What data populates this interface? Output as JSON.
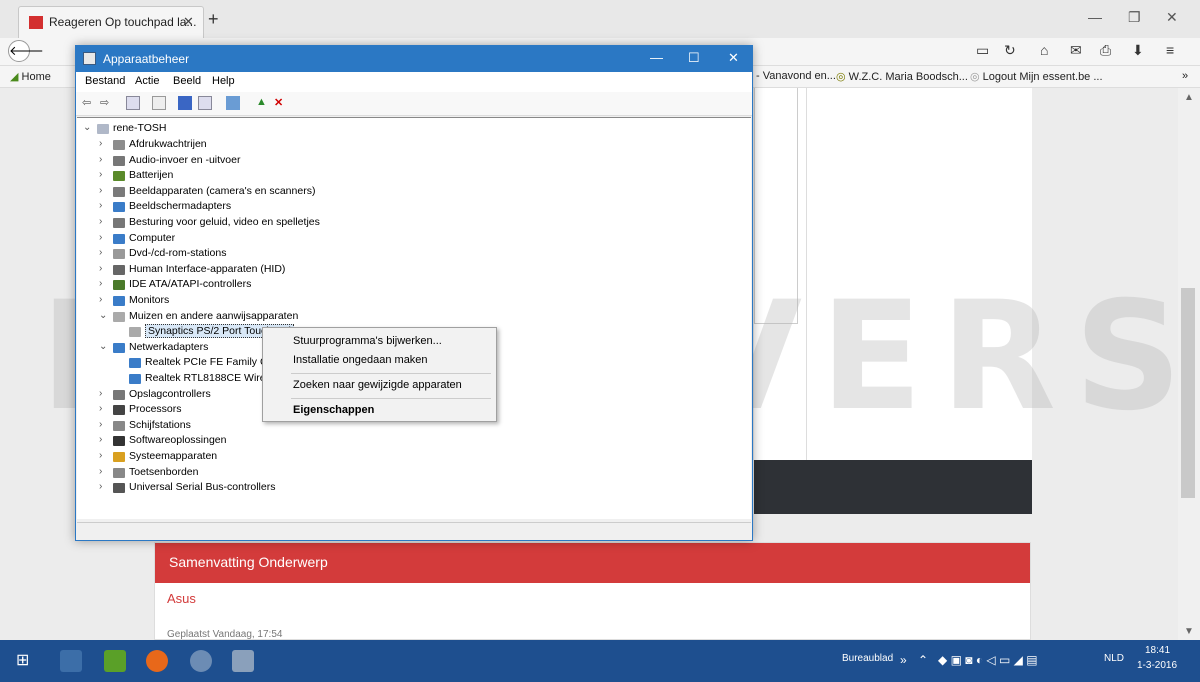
{
  "browser": {
    "tab_title": "Reageren Op touchpad la...",
    "bookmarks": {
      "home": "Home",
      "vanavond": "- Vanavond en...",
      "wzc": "W.Z.C. Maria Boodsch...",
      "logout": "Logout Mijn essent.be ..."
    }
  },
  "device_manager": {
    "title": "Apparaatbeheer",
    "menu": [
      "Bestand",
      "Actie",
      "Beeld",
      "Help"
    ],
    "root": "rene-TOSH",
    "nodes": [
      {
        "label": "Afdrukwachtrijen",
        "expanded": false
      },
      {
        "label": "Audio-invoer en -uitvoer",
        "expanded": false
      },
      {
        "label": "Batterijen",
        "expanded": false
      },
      {
        "label": "Beeldapparaten (camera's en scanners)",
        "expanded": false
      },
      {
        "label": "Beeldschermadapters",
        "expanded": false
      },
      {
        "label": "Besturing voor geluid, video en spelletjes",
        "expanded": false
      },
      {
        "label": "Computer",
        "expanded": false
      },
      {
        "label": "Dvd-/cd-rom-stations",
        "expanded": false
      },
      {
        "label": "Human Interface-apparaten (HID)",
        "expanded": false
      },
      {
        "label": "IDE ATA/ATAPI-controllers",
        "expanded": false
      },
      {
        "label": "Monitors",
        "expanded": false
      },
      {
        "label": "Muizen en andere aanwijsapparaten",
        "expanded": true
      },
      {
        "label": "Synaptics PS/2 Port TouchPad",
        "child": true,
        "selected": true
      },
      {
        "label": "Netwerkadapters",
        "expanded": true
      },
      {
        "label": "Realtek PCIe FE Family Co",
        "child": true
      },
      {
        "label": "Realtek RTL8188CE Wirele",
        "child": true
      },
      {
        "label": "Opslagcontrollers",
        "expanded": false
      },
      {
        "label": "Processors",
        "expanded": false
      },
      {
        "label": "Schijfstations",
        "expanded": false
      },
      {
        "label": "Softwareoplossingen",
        "expanded": false
      },
      {
        "label": "Systeemapparaten",
        "expanded": false
      },
      {
        "label": "Toetsenborden",
        "expanded": false
      },
      {
        "label": "Universal Serial Bus-controllers",
        "expanded": false
      }
    ]
  },
  "context_menu": {
    "update": "Stuurprogramma's bijwerken...",
    "uninstall": "Installatie ongedaan maken",
    "scan": "Zoeken naar gewijzigde apparaten",
    "properties": "Eigenschappen"
  },
  "page": {
    "panel_header": "Samenvatting Onderwerp",
    "panel_title": "Asus",
    "panel_meta": "Geplaatst Vandaag, 17:54"
  },
  "watermark": "DEMO VERSION",
  "taskbar": {
    "desktop_label": "Bureaublad",
    "lang": "NLD",
    "time": "18:41",
    "date": "1-3-2016"
  }
}
